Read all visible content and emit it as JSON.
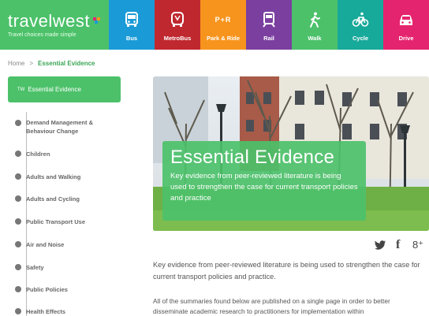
{
  "brand": {
    "name": "travelwest",
    "tagline": "Travel choices made simple"
  },
  "nav": [
    {
      "label": "Bus",
      "color": "#1a9bd7",
      "icon": "bus-icon"
    },
    {
      "label": "MetroBus",
      "color": "#c0282f",
      "icon": "metrobus-icon"
    },
    {
      "label": "Park & Ride",
      "color": "#f7941d",
      "icon": "park-ride-icon",
      "badge": "P+R"
    },
    {
      "label": "Rail",
      "color": "#7b3fa0",
      "icon": "train-icon"
    },
    {
      "label": "Walk",
      "color": "#4cc16a",
      "icon": "walk-icon"
    },
    {
      "label": "Cycle",
      "color": "#17a99a",
      "icon": "bicycle-icon"
    },
    {
      "label": "Drive",
      "color": "#e5246f",
      "icon": "car-icon"
    }
  ],
  "breadcrumb": {
    "home": "Home",
    "separator": ">",
    "current": "Essential Evidence"
  },
  "sidebar": {
    "active": {
      "prefix": "TW",
      "label": "Essential Evidence"
    },
    "items": [
      {
        "label": "Demand Management & Behaviour Change"
      },
      {
        "label": "Children"
      },
      {
        "label": "Adults and Walking"
      },
      {
        "label": "Adults and Cycling"
      },
      {
        "label": "Public Transport Use"
      },
      {
        "label": "Air and Noise"
      },
      {
        "label": "Safety"
      },
      {
        "label": "Public Policies"
      },
      {
        "label": "Health Effects"
      }
    ]
  },
  "hero": {
    "title": "Essential Evidence",
    "subtitle": "Key evidence from peer-reviewed literature is being used to strengthen the case for current transport policies and practice"
  },
  "social": {
    "twitter": "twitter-icon",
    "facebook": "f",
    "googleplus": "8⁺"
  },
  "content": {
    "para1": "Key evidence from peer-reviewed literature is being used to strengthen the case for current transport policies and practice.",
    "para2": "All of the summaries found below are published on a single page in order to better disseminate academic research to practitioners for implementation within"
  },
  "colors": {
    "accent": "#4cc16a"
  }
}
